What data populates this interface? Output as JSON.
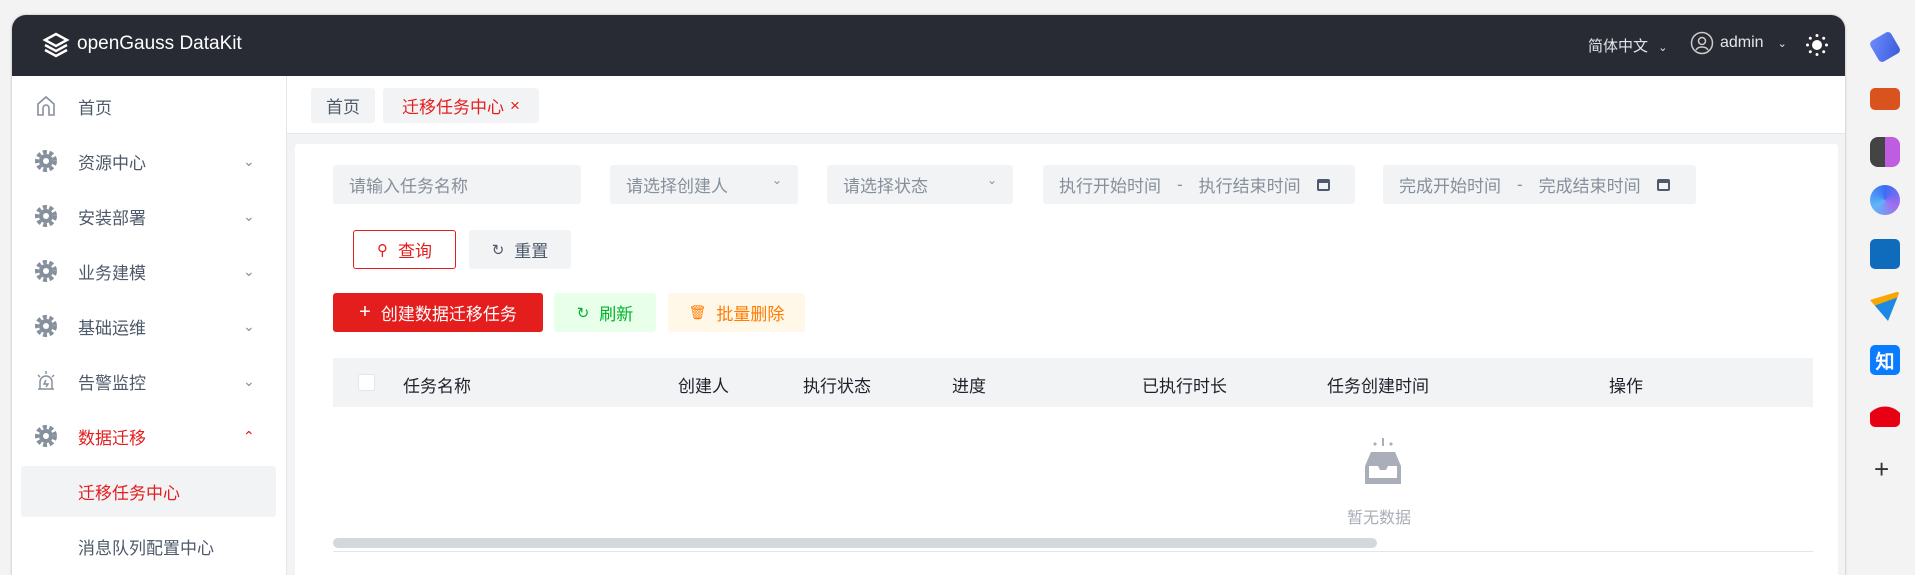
{
  "header": {
    "app_title": "openGauss DataKit",
    "language": "简体中文",
    "user": "admin"
  },
  "sidebar": {
    "items": [
      {
        "label": "首页",
        "icon": "home-icon"
      },
      {
        "label": "资源中心",
        "icon": "gear-icon"
      },
      {
        "label": "安装部署",
        "icon": "gear-icon"
      },
      {
        "label": "业务建模",
        "icon": "gear-icon"
      },
      {
        "label": "基础运维",
        "icon": "gear-icon"
      },
      {
        "label": "告警监控",
        "icon": "alarm-icon"
      },
      {
        "label": "数据迁移",
        "icon": "gear-icon"
      }
    ],
    "sub_items": [
      {
        "label": "迁移任务中心"
      },
      {
        "label": "消息队列配置中心"
      }
    ]
  },
  "tabs": [
    {
      "label": "首页"
    },
    {
      "label": "迁移任务中心",
      "close": "×"
    }
  ],
  "filters": {
    "task_name_placeholder": "请输入任务名称",
    "creator_placeholder": "请选择创建人",
    "status_placeholder": "请选择状态",
    "exec_start": "执行开始时间",
    "exec_end": "执行结束时间",
    "finish_start": "完成开始时间",
    "finish_end": "完成结束时间",
    "sep": "-",
    "query": "查询",
    "reset": "重置"
  },
  "actions": {
    "create": "创建数据迁移任务",
    "refresh": "刷新",
    "batch_delete": "批量删除"
  },
  "table": {
    "columns": [
      "任务名称",
      "创建人",
      "执行状态",
      "进度",
      "已执行时长",
      "任务创建时间",
      "操作"
    ],
    "empty_text": "暂无数据"
  },
  "colors": {
    "accent": "#e41d1d",
    "topbar": "#282b33",
    "refresh": "#00b42a",
    "delete": "#ff7d00"
  }
}
